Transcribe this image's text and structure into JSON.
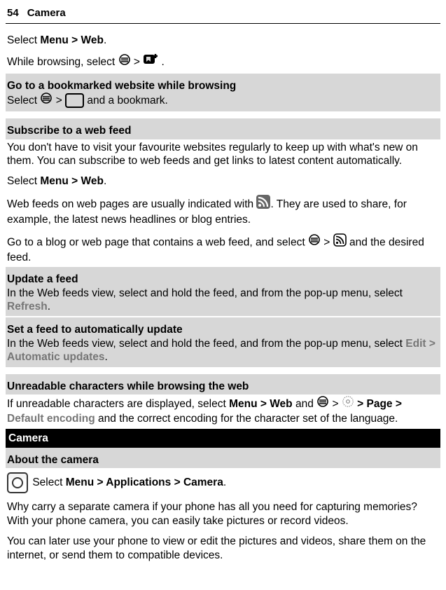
{
  "header": {
    "page": "54",
    "chapter": "Camera"
  },
  "t": {
    "select": "Select ",
    "menu": "Menu",
    "gt_web": " > Web",
    "period": ".",
    "while_browsing": "While browsing, select ",
    "go_bookmark_title": "Go to a bookmarked website while browsing",
    "and_bookmark": " and a bookmark.",
    "subscribe_title": "Subscribe to a web feed",
    "subscribe_body": "You don't have to visit your favourite websites regularly to keep up with what's new on them. You can subscribe to web feeds and get links to latest content automatically.",
    "feeds_intro_a": "Web feeds on web pages are usually indicated with ",
    "feeds_intro_b": ". They are used to share, for example, the latest news headlines or blog entries.",
    "goto_blog_a": "Go to a blog or web page that contains a web feed, and select ",
    "goto_blog_b": " and the desired feed.",
    "update_title": "Update a feed",
    "update_body_a": "In the Web feeds view, select and hold the feed, and from the pop-up menu, select ",
    "refresh": "Refresh",
    "auto_title": "Set a feed to automatically update",
    "auto_body_a": "In the Web feeds view, select and hold the feed, and from the pop-up menu, select ",
    "edit": "Edit",
    "gt_auto": " > Automatic updates",
    "unreadable_title": "Unreadable characters while browsing the web",
    "unreadable_a": "If unreadable characters are displayed, select ",
    "unreadable_b": " and ",
    "gt_page": " > Page",
    "gt_default_enc": "Default encoding",
    "unreadable_c": " and the correct encoding for the character set of the language.",
    "camera_bar": "Camera",
    "about_camera": "About the camera",
    "gt_apps": " > Applications",
    "gt_camera": " > Camera",
    "camera_p1": "Why carry a separate camera if your phone has all you need for capturing memories? With your phone camera, you can easily take pictures or record videos.",
    "camera_p2": "You can later use your phone to view or edit the pictures and videos, share them on the internet, or send them to compatible devices.",
    "arrow": " > "
  }
}
